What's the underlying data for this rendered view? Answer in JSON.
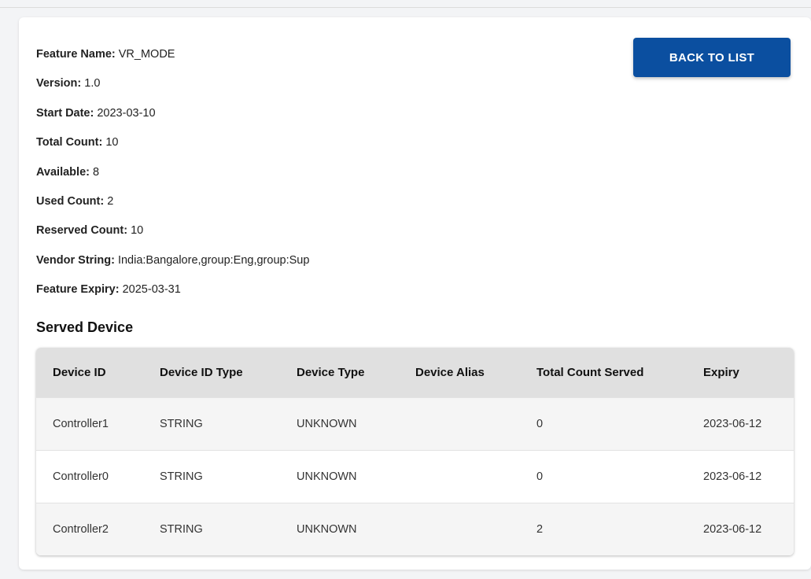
{
  "feature": {
    "fields": [
      {
        "label": "Feature Name:",
        "value": "VR_MODE"
      },
      {
        "label": "Version:",
        "value": "1.0"
      },
      {
        "label": "Start Date:",
        "value": "2023-03-10"
      },
      {
        "label": "Total Count:",
        "value": "10"
      },
      {
        "label": "Available:",
        "value": "8"
      },
      {
        "label": "Used Count:",
        "value": "2"
      },
      {
        "label": "Reserved Count:",
        "value": "10"
      },
      {
        "label": "Vendor String:",
        "value": "India:Bangalore,group:Eng,group:Sup"
      },
      {
        "label": "Feature Expiry:",
        "value": "2025-03-31"
      }
    ]
  },
  "actions": {
    "back_label": "BACK TO LIST"
  },
  "served_device": {
    "title": "Served Device",
    "columns": [
      "Device ID",
      "Device ID Type",
      "Device Type",
      "Device Alias",
      "Total Count Served",
      "Expiry"
    ],
    "rows": [
      [
        "Controller1",
        "STRING",
        "UNKNOWN",
        "",
        "0",
        "2023-06-12"
      ],
      [
        "Controller0",
        "STRING",
        "UNKNOWN",
        "",
        "0",
        "2023-06-12"
      ],
      [
        "Controller2",
        "STRING",
        "UNKNOWN",
        "",
        "2",
        "2023-06-12"
      ]
    ]
  },
  "colors": {
    "accent": "#0b4fa0",
    "header_bg": "#e0e0e0",
    "row_alt_bg": "#f5f5f5"
  }
}
